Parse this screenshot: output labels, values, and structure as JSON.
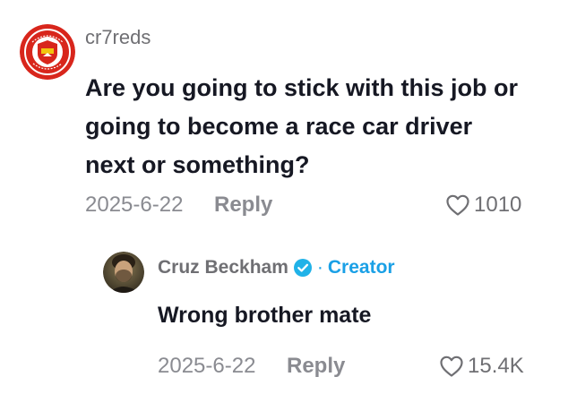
{
  "comment": {
    "username": "cr7reds",
    "avatar_icon": "manchester-united-crest",
    "text_lines": [
      "Are you going to stick with this job or",
      "going to become a race car driver",
      "next or something?"
    ],
    "date": "2025-6-22",
    "reply_label": "Reply",
    "like_icon": "heart-outline",
    "like_count": "1010"
  },
  "reply": {
    "username": "Cruz Beckham",
    "verified_icon": "verified-badge",
    "separator": "·",
    "role_label": "Creator",
    "text": "Wrong brother mate",
    "date": "2025-6-22",
    "reply_label": "Reply",
    "like_icon": "heart-outline",
    "like_count": "15.4K"
  },
  "colors": {
    "text_primary": "#161823",
    "text_secondary": "#8a8b91",
    "creator_blue": "#1aa0e6",
    "crest_red": "#d8261c"
  }
}
